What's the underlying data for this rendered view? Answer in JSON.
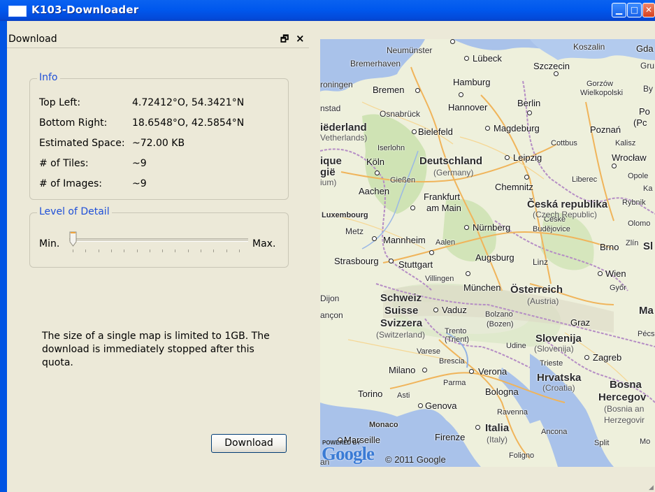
{
  "window": {
    "title": "K103-Downloader",
    "colors": {
      "title_bar": "#0058ee",
      "chrome": "#ece9d8",
      "legend": "#1f4fd8"
    }
  },
  "dock": {
    "title": "Download",
    "float_icon": "float-icon",
    "close_glyph": "×"
  },
  "info": {
    "legend": "Info",
    "rows": [
      {
        "label": "Top Left:",
        "value": "4.72412°O, 54.3421°N"
      },
      {
        "label": "Bottom Right:",
        "value": "18.6548°O, 42.5854°N"
      },
      {
        "label": "Estimated Space:",
        "value": "~72.00 KB"
      },
      {
        "label": "# of Tiles:",
        "value": "~9"
      },
      {
        "label": "# of Images:",
        "value": "~9"
      }
    ]
  },
  "detail": {
    "legend": "Level of Detail",
    "min_label": "Min.",
    "max_label": "Max.",
    "slider_level": 0
  },
  "note": "The size of a single map is limited to 1GB. The download is immediately stopped after this quota.",
  "download_button": "Download",
  "map": {
    "countries": [
      "Deutschland",
      "(Germany)",
      "Česká republika",
      "(Czech Republic)",
      "Österreich",
      "(Austria)",
      "Schweiz",
      "Suisse",
      "Svizzera",
      "(Switzerland)",
      "Italia",
      "(Italy)",
      "Slovenija",
      "(Slovenija)",
      "Hrvatska",
      "(Croatia)",
      "Bosna",
      "Hercegov",
      "(Bosnia an",
      "Herzegovir",
      "Luxembourg",
      "iëderland",
      "Vetherlands)"
    ],
    "cities": [
      "Neumünster",
      "Lübeck",
      "Koszalin",
      "Gda",
      "Bremerhaven",
      "Szczecin",
      "Gru",
      "roningen",
      "Bremen",
      "Hamburg",
      "Gorzów",
      "Wielkopolski",
      "By",
      "Osnabrück",
      "Hannover",
      "Berlin",
      "Po",
      "nstad",
      "Bielefeld",
      "Magdeburg",
      "Poznań",
      "(Pc",
      "Cottbus",
      "Kalisz",
      "Iserlohn",
      "Köln",
      "Leipzig",
      "Wrocław",
      "ique",
      "gië",
      "ium)",
      "Gießen",
      "Liberec",
      "Opole",
      "Ka",
      "Aachen",
      "Frankfurt",
      "am Main",
      "Chemnitz",
      "Rybnik",
      "Metz",
      "Nürnberg",
      "České",
      "Budějovice",
      "Olomo",
      "Mannheim",
      "Aalen",
      "Brno",
      "Zlín",
      "Sl",
      "Strasbourg",
      "Stuttgart",
      "Augsburg",
      "Linz",
      "Wien",
      "Villingen",
      "München",
      "Győr",
      "Dijon",
      "Vaduz",
      "Bolzano",
      "(Bozen)",
      "Ma",
      "ançon",
      "Trento",
      "(Trient)",
      "Graz",
      "Pécs",
      "Varese",
      "Udine",
      "Brescia",
      "Trieste",
      "Zagreb",
      "Milano",
      "Verona",
      "Parma",
      "Bologna",
      "Torino",
      "Asti",
      "Genova",
      "Ravenna",
      "Monaco",
      "Ancona",
      "Firenze",
      "Split",
      "Mo",
      "Marseille",
      "Foligno",
      "an"
    ],
    "attribution": "© 2011 Google",
    "logo_text": "Google",
    "powered_by": "POWERED BY"
  }
}
